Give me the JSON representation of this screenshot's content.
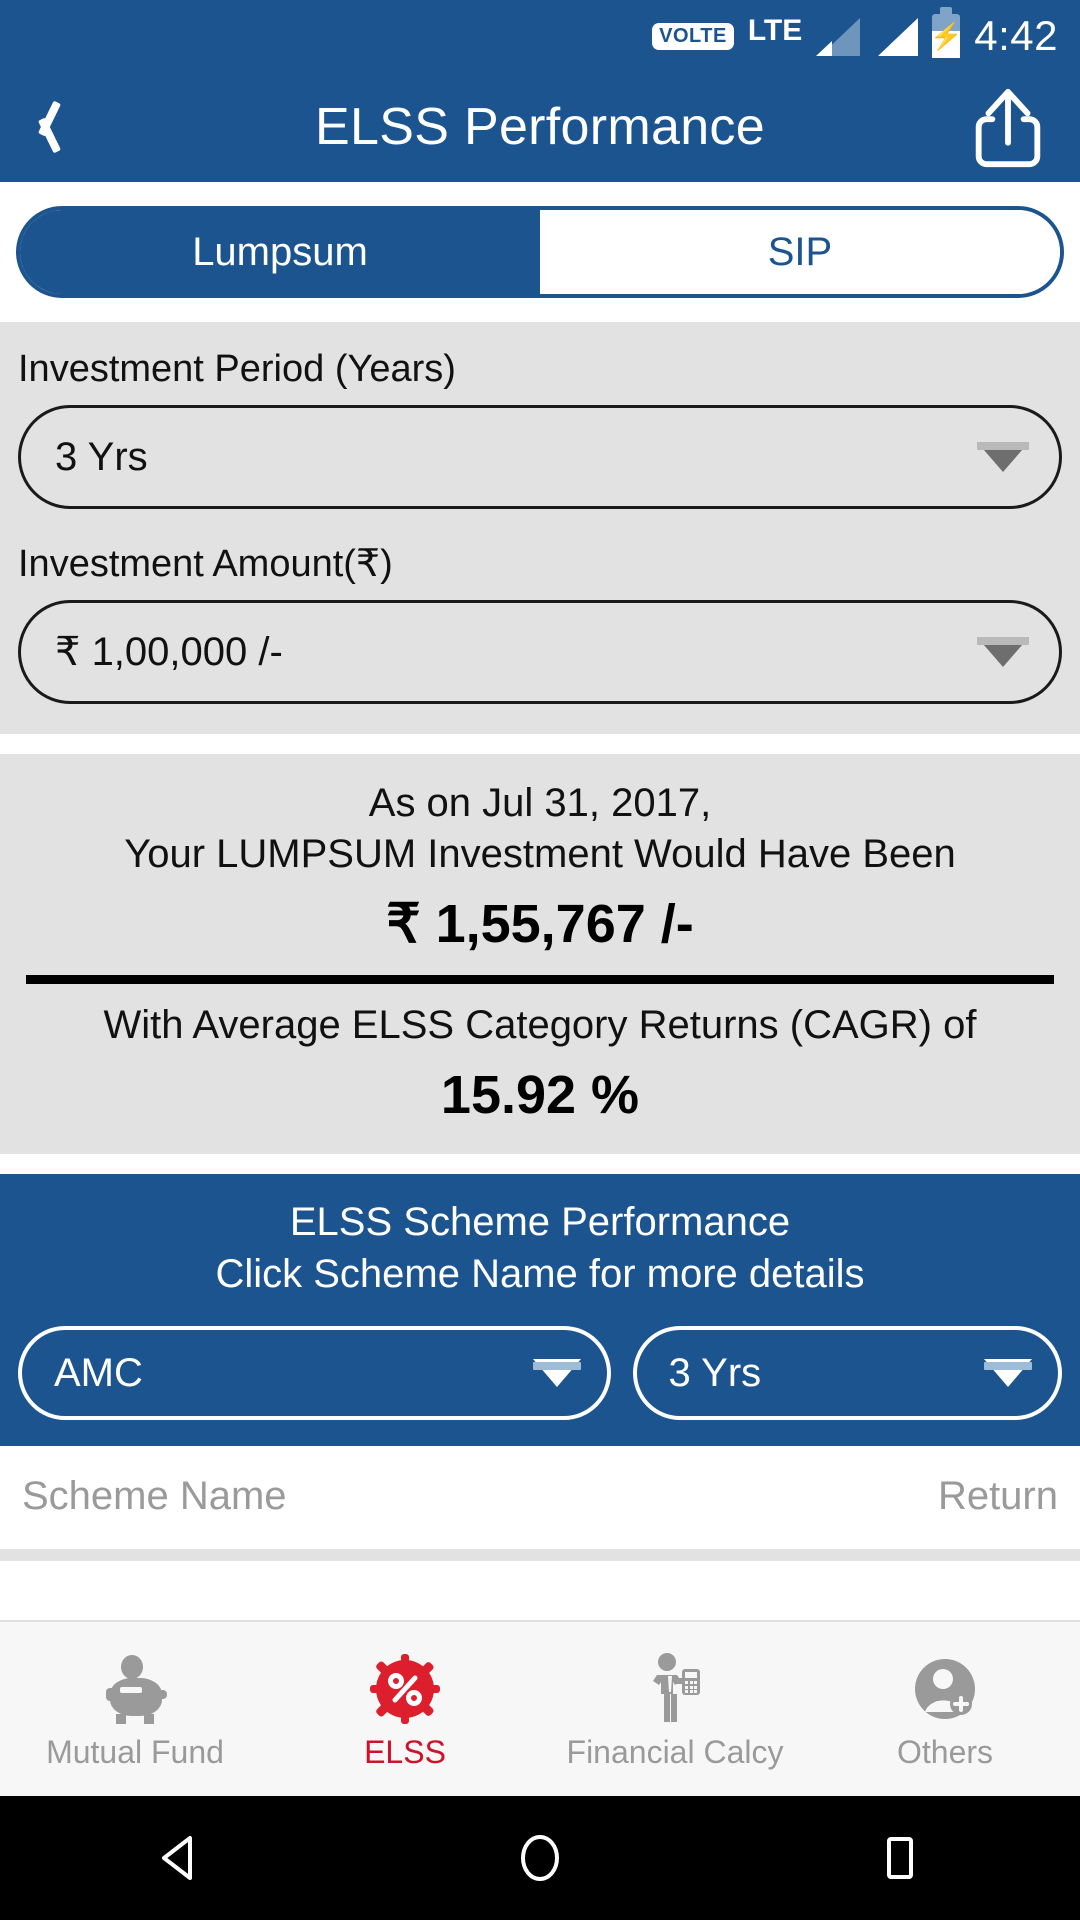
{
  "status_bar": {
    "volte_badge": "VOLTE",
    "network_type": "LTE",
    "signal_1_icon": "signal-bars-dim-icon",
    "signal_2_icon": "signal-bars-full-icon",
    "battery_icon": "battery-charging-icon",
    "time": "4:42"
  },
  "app_bar": {
    "back_icon": "back-chevron-icon",
    "title": "ELSS Performance",
    "share_icon": "share-icon"
  },
  "mode_toggle": {
    "options": [
      {
        "label": "Lumpsum",
        "active": true
      },
      {
        "label": "SIP",
        "active": false
      }
    ]
  },
  "inputs": {
    "period": {
      "label": "Investment Period (Years)",
      "value": "3 Yrs",
      "caret_icon": "chevron-down-icon"
    },
    "amount": {
      "label": "Investment Amount(₹)",
      "value": "₹ 1,00,000 /-",
      "caret_icon": "chevron-down-icon"
    }
  },
  "result": {
    "as_on": "As on Jul 31, 2017,",
    "subtitle": "Your LUMPSUM Investment Would Have Been",
    "value": "₹ 1,55,767 /-",
    "cagr_label": "With Average ELSS Category Returns (CAGR) of",
    "cagr_value": "15.92 %"
  },
  "scheme_section": {
    "title": "ELSS Scheme Performance",
    "hint": "Click Scheme Name for more details",
    "amc_filter": {
      "value": "AMC",
      "caret_icon": "chevron-down-icon"
    },
    "period_filter": {
      "value": "3 Yrs",
      "caret_icon": "chevron-down-icon"
    }
  },
  "scheme_table": {
    "col_name": "Scheme Name",
    "col_return": "Return"
  },
  "bottom_nav": {
    "items": [
      {
        "label": "Mutual Fund",
        "icon": "piggy-bank-icon",
        "active": false
      },
      {
        "label": "ELSS",
        "icon": "percent-badge-icon",
        "active": true
      },
      {
        "label": "Financial Calcy",
        "icon": "person-calculator-icon",
        "active": false
      },
      {
        "label": "Others",
        "icon": "person-add-icon",
        "active": false
      }
    ]
  },
  "system_nav": {
    "back_icon": "android-back-icon",
    "home_icon": "android-home-icon",
    "recents_icon": "android-recents-icon"
  },
  "colors": {
    "brand_blue": "#1c5490",
    "panel_gray": "#e2e2e2",
    "accent_red": "#d0112b",
    "muted_text": "#9a9a9a"
  }
}
